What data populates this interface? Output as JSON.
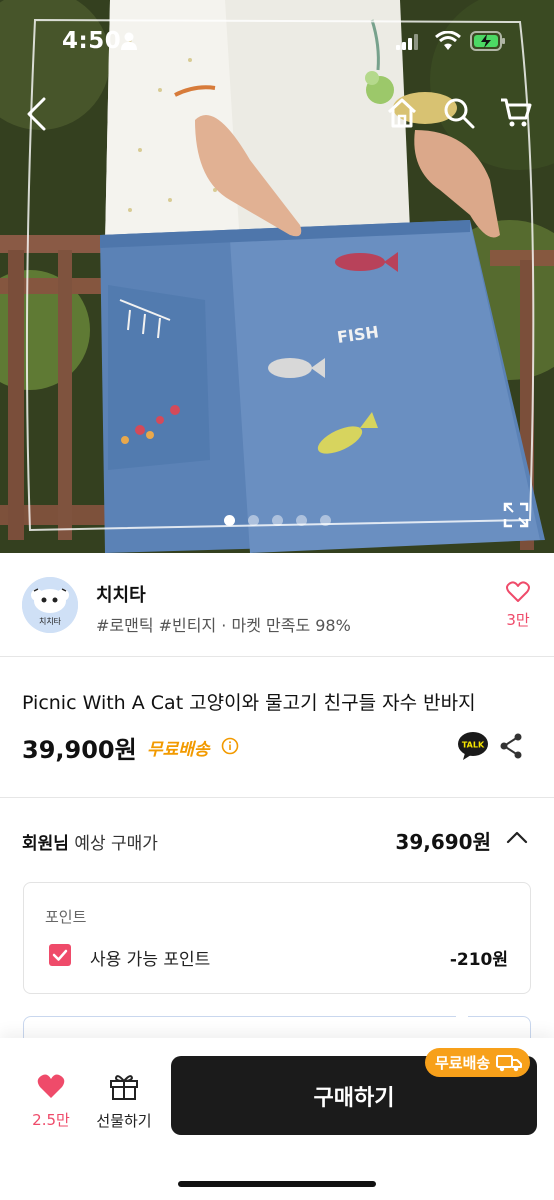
{
  "status_bar": {
    "time": "4:50"
  },
  "hero": {
    "photo_text": "FISH",
    "total_images": 5,
    "active_index": 0
  },
  "seller": {
    "name": "치치타",
    "avatar_text": "치치타",
    "tags": "#로맨틱 #빈티지 · 마켓 만족도 98%",
    "like_count": "3만"
  },
  "product": {
    "title": "Picnic With A Cat 고양이와 물고기 친구들 자수 반바지",
    "price": "39,900원",
    "shipping": "무료배송",
    "talk_label": "TALK"
  },
  "member": {
    "label_bold": "회원님",
    "label_rest": " 예상 구매가",
    "price": "39,690원"
  },
  "points": {
    "header": "포인트",
    "label": "사용 가능 포인트",
    "value": "-210원",
    "checked": true
  },
  "bottom": {
    "like_count": "2.5만",
    "gift_label": "선물하기",
    "buy_label": "구매하기",
    "ship_badge": "무료배송"
  },
  "colors": {
    "accent_pink": "#ef4b6a",
    "shipping_orange": "#f29a00",
    "badge_orange": "#f7a01a",
    "buy_button": "#1b1b1b"
  }
}
